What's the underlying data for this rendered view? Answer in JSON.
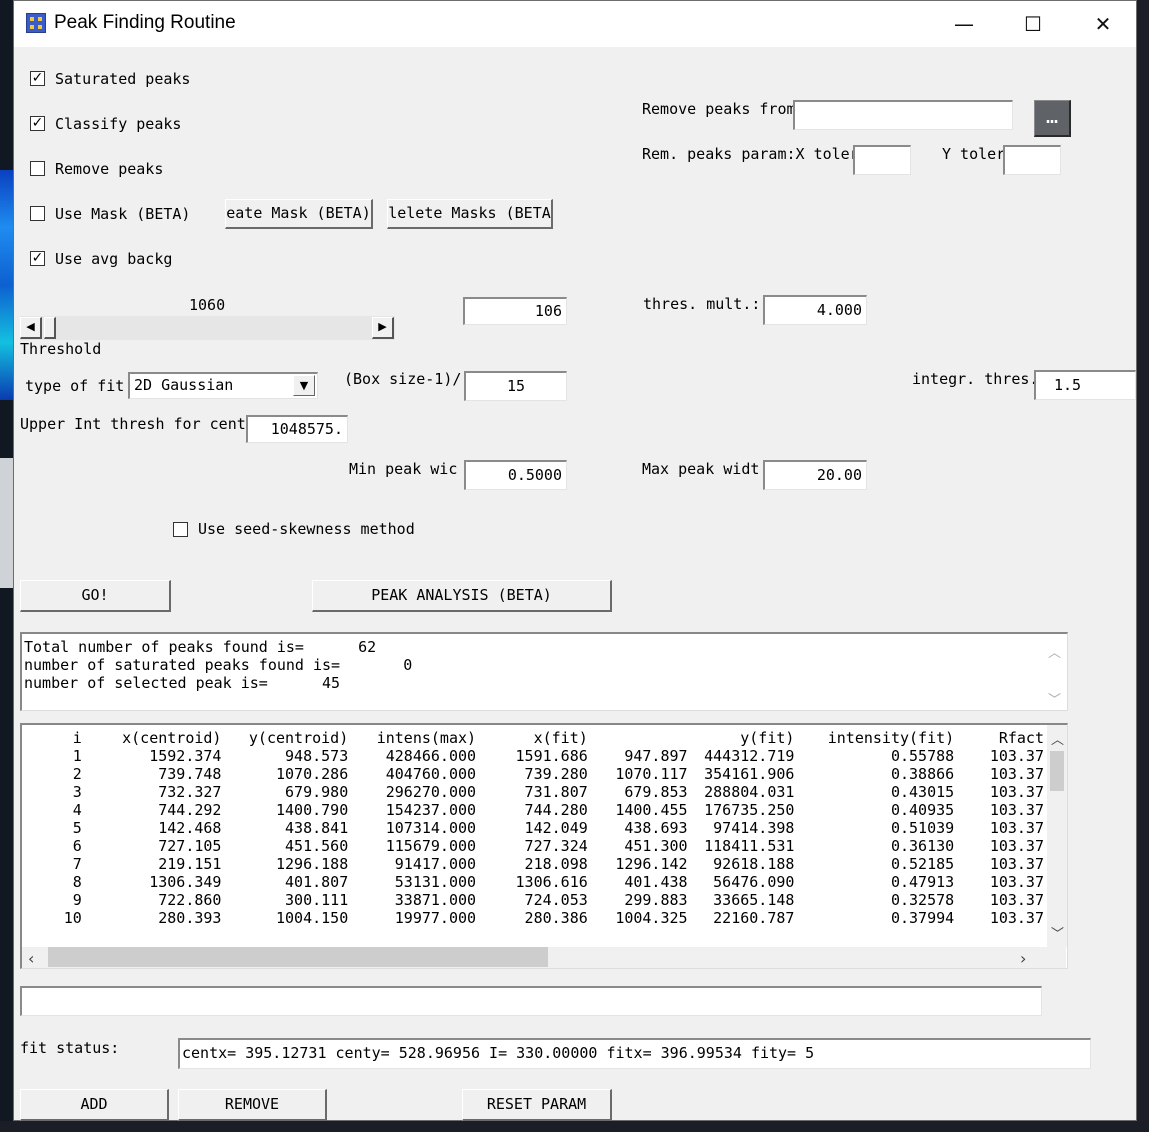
{
  "window": {
    "title": "Peak Finding Routine",
    "minimize": "—",
    "maximize": "☐",
    "close": "✕"
  },
  "checkboxes": {
    "saturated": {
      "label": "Saturated peaks",
      "checked": true,
      "mark": "✓"
    },
    "classify": {
      "label": "Classify peaks",
      "checked": true,
      "mark": "✓"
    },
    "remove": {
      "label": "Remove peaks",
      "checked": false,
      "mark": ""
    },
    "use_mask": {
      "label": "Use Mask (BETA)",
      "checked": false,
      "mark": ""
    },
    "use_avg_backg": {
      "label": "Use avg backg",
      "checked": true,
      "mark": "✓"
    },
    "seed_skewness": {
      "label": "Use seed-skewness method",
      "checked": false,
      "mark": ""
    }
  },
  "mask_buttons": {
    "create": "eate Mask (BETA)",
    "delete": "lelete Masks (BETA"
  },
  "remove_from": {
    "label": "Remove peaks from",
    "value": "",
    "browse": "…"
  },
  "rem_params": {
    "label": "Rem. peaks param:X toler",
    "x_toler": "",
    "y_label": "Y toler",
    "y_toler": ""
  },
  "threshold": {
    "slider_value": "1060",
    "label": "Threshold",
    "field": "106",
    "slider_fraction": 0.0
  },
  "thres_mult": {
    "label": "thres. mult.:",
    "value": "4.000"
  },
  "fit": {
    "label": "type of fit",
    "selected": "2D Gaussian"
  },
  "box_size": {
    "label": "(Box size-1)/",
    "value": "15"
  },
  "integr_thres": {
    "label": "integr. thres.:",
    "value": "1.5"
  },
  "upper_int": {
    "label": "Upper Int thresh for cent",
    "value": "1048575."
  },
  "min_peak": {
    "label": "Min peak wic",
    "value": "0.5000"
  },
  "max_peak": {
    "label": "Max peak widt",
    "value": "20.00"
  },
  "actions": {
    "go": "GO!",
    "peak_analysis": "PEAK ANALYSIS (BETA)",
    "add": "ADD",
    "remove": "REMOVE",
    "reset": "RESET PARAM"
  },
  "summary": {
    "line1": "Total number of peaks found is=      62",
    "line2": "number of saturated peaks found is=       0",
    "line3": "number of selected peak is=      45"
  },
  "table": {
    "headers": [
      "i",
      "x(centroid)",
      "y(centroid)",
      "intens(max)",
      "x(fit)",
      "y(fit)",
      "intensity(fit)",
      "Rfact"
    ],
    "rows": [
      [
        "1",
        "1592.374",
        "948.573",
        "428466.000",
        "1591.686",
        "947.897",
        "444312.719",
        "0.55788",
        "103.37"
      ],
      [
        "2",
        "739.748",
        "1070.286",
        "404760.000",
        "739.280",
        "1070.117",
        "354161.906",
        "0.38866",
        "103.37"
      ],
      [
        "3",
        "732.327",
        "679.980",
        "296270.000",
        "731.807",
        "679.853",
        "288804.031",
        "0.43015",
        "103.37"
      ],
      [
        "4",
        "744.292",
        "1400.790",
        "154237.000",
        "744.280",
        "1400.455",
        "176735.250",
        "0.40935",
        "103.37"
      ],
      [
        "5",
        "142.468",
        "438.841",
        "107314.000",
        "142.049",
        "438.693",
        "97414.398",
        "0.51039",
        "103.37"
      ],
      [
        "6",
        "727.105",
        "451.560",
        "115679.000",
        "727.324",
        "451.300",
        "118411.531",
        "0.36130",
        "103.37"
      ],
      [
        "7",
        "219.151",
        "1296.188",
        "91417.000",
        "218.098",
        "1296.142",
        "92618.188",
        "0.52185",
        "103.37"
      ],
      [
        "8",
        "1306.349",
        "401.807",
        "53131.000",
        "1306.616",
        "401.438",
        "56476.090",
        "0.47913",
        "103.37"
      ],
      [
        "9",
        "722.860",
        "300.111",
        "33871.000",
        "724.053",
        "299.883",
        "33665.148",
        "0.32578",
        "103.37"
      ],
      [
        "10",
        "280.393",
        "1004.150",
        "19977.000",
        "280.386",
        "1004.325",
        "22160.787",
        "0.37994",
        "103.37"
      ]
    ]
  },
  "status_field": "",
  "fit_status": {
    "label": "fit status:",
    "value": "centx=       395.12731 centy=       528.96956  I=       330.00000 fitx=       396.99534 fity=       5"
  }
}
